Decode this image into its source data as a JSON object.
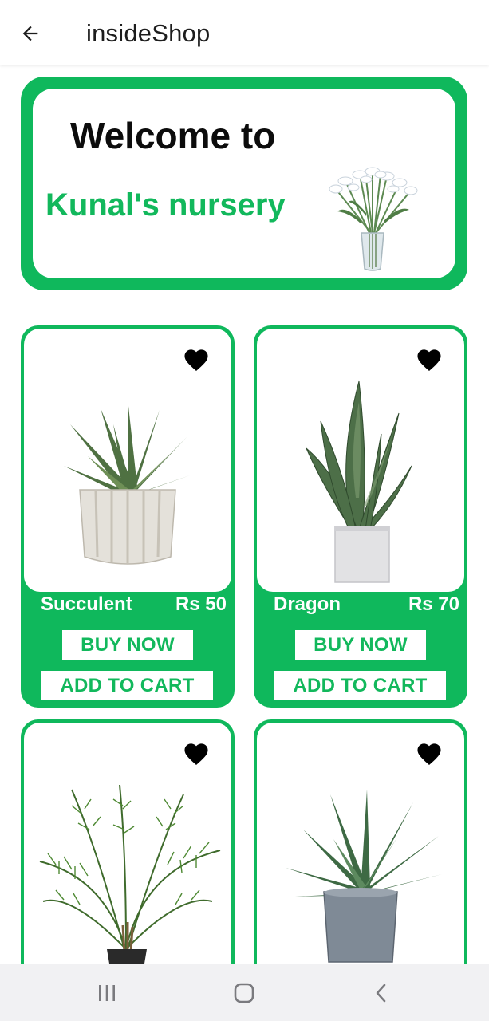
{
  "app_bar": {
    "title": "insideShop",
    "back_icon": "arrow-left-icon"
  },
  "banner": {
    "welcome": "Welcome to",
    "shop_name": "Kunal's nursery",
    "image": "white-lily-vase"
  },
  "products": [
    {
      "name": "Succulent",
      "price": "Rs 50",
      "image": "succulent-plant",
      "buy_label": "BUY NOW",
      "cart_label": "ADD TO CART",
      "favorite_icon": "heart-icon"
    },
    {
      "name": "Dragon",
      "price": "Rs 70",
      "image": "snake-plant",
      "buy_label": "BUY NOW",
      "cart_label": "ADD TO CART",
      "favorite_icon": "heart-icon"
    },
    {
      "image": "areca-palm",
      "favorite_icon": "heart-icon"
    },
    {
      "image": "aloe-plant",
      "favorite_icon": "heart-icon"
    }
  ],
  "system_nav": {
    "recents_icon": "recents-icon",
    "home_icon": "home-icon",
    "back_icon": "back-chevron-icon"
  },
  "colors": {
    "accent": "#0fb85c",
    "text_dark": "#0c0c0c",
    "nav_bg": "#f1f1f3"
  }
}
